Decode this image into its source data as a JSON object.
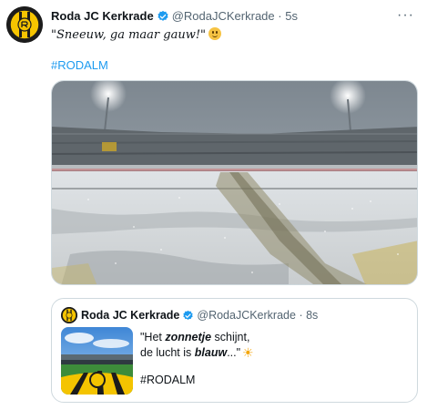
{
  "tweet": {
    "display_name": "Roda JC Kerkrade",
    "handle": "@RodaJCKerkrade",
    "separator": "·",
    "time": "5s",
    "text": "\"Sneeuw, ga maar gauw!\"",
    "hashtag": "#RODALM",
    "more_label": "···"
  },
  "quoted": {
    "display_name": "Roda JC Kerkrade",
    "handle": "@RodaJCKerkrade",
    "separator": "·",
    "time": "8s",
    "line1_prefix": "\"Het ",
    "line1_emph": "zonnetje",
    "line1_suffix": " schijnt,",
    "line2_prefix": "de lucht is ",
    "line2_emph": "blauw",
    "line2_suffix": "...\"",
    "hashtag": "#RODALM"
  },
  "icons": {
    "verified": "verified-badge-icon",
    "emoji": "smiling-face-emoji",
    "sun": "sun-emoji",
    "more": "more-horizontal-icon"
  },
  "colors": {
    "link": "#1d9bf0",
    "verified": "#1d9bf0",
    "club_yellow": "#f6c400",
    "muted": "#536471"
  }
}
